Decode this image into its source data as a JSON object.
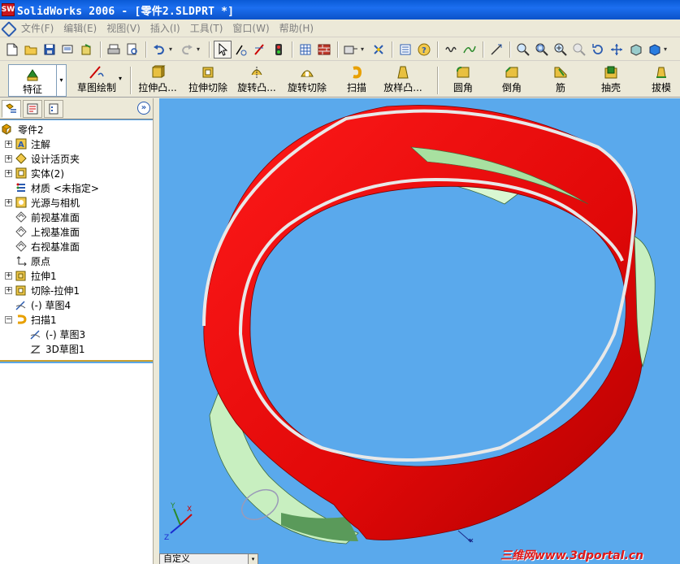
{
  "window": {
    "title": "SolidWorks 2006 - [零件2.SLDPRT *]",
    "app_icon_text": "SW"
  },
  "menu": {
    "items": [
      "文件(F)",
      "编辑(E)",
      "视图(V)",
      "插入(I)",
      "工具(T)",
      "窗口(W)",
      "帮助(H)"
    ]
  },
  "standard_toolbar": {
    "icons": [
      "new-document-icon",
      "open-icon",
      "save-icon",
      "print-preview-icon",
      "options-icon",
      "print-icon",
      "preview-icon",
      "undo-icon",
      "redo-icon",
      "select-icon",
      "smart-dimension-icon",
      "sketch-icon",
      "traffic-light-icon",
      "grid-icon",
      "brick-icon",
      "view-orientation-icon",
      "rebuild-icon",
      "properties-icon",
      "help-icon",
      "spring-icon",
      "curve-icon",
      "measure-icon",
      "zoom-to-fit-icon",
      "zoom-window-icon",
      "zoom-in-out-icon",
      "zoom-selection-icon",
      "rotate-icon",
      "pan-icon",
      "shaded-icon",
      "display-style-icon"
    ]
  },
  "feature_toolbar": {
    "modes": [
      {
        "label": "特征",
        "icon": "feature-icon"
      },
      {
        "label": "草图绘制",
        "icon": "sketch-draw-icon"
      }
    ],
    "buttons": [
      {
        "label": "拉伸凸...",
        "icon": "extrude-boss-icon"
      },
      {
        "label": "拉伸切除",
        "icon": "extrude-cut-icon"
      },
      {
        "label": "旋转凸...",
        "icon": "revolve-boss-icon"
      },
      {
        "label": "旋转切除",
        "icon": "revolve-cut-icon"
      },
      {
        "label": "扫描",
        "icon": "sweep-icon"
      },
      {
        "label": "放样凸...",
        "icon": "loft-icon"
      },
      {
        "label": "圆角",
        "icon": "fillet-icon"
      },
      {
        "label": "倒角",
        "icon": "chamfer-icon"
      },
      {
        "label": "筋",
        "icon": "rib-icon"
      },
      {
        "label": "抽壳",
        "icon": "shell-icon"
      },
      {
        "label": "拔模",
        "icon": "draft-icon"
      }
    ]
  },
  "feature_tree": {
    "collapse_symbol": "»",
    "root": "零件2",
    "items": [
      {
        "label": "注解",
        "icon": "annotation-icon",
        "expander": "+",
        "indent": 1
      },
      {
        "label": "设计活页夹",
        "icon": "design-binder-icon",
        "expander": "+",
        "indent": 1
      },
      {
        "label": "实体(2)",
        "icon": "solid-bodies-icon",
        "expander": "+",
        "indent": 1
      },
      {
        "label": "材质 <未指定>",
        "icon": "material-icon",
        "expander": "",
        "indent": 1
      },
      {
        "label": "光源与相机",
        "icon": "lights-icon",
        "expander": "+",
        "indent": 1
      },
      {
        "label": "前视基准面",
        "icon": "plane-icon",
        "expander": "",
        "indent": 1
      },
      {
        "label": "上视基准面",
        "icon": "plane-icon",
        "expander": "",
        "indent": 1
      },
      {
        "label": "右视基准面",
        "icon": "plane-icon",
        "expander": "",
        "indent": 1
      },
      {
        "label": "原点",
        "icon": "origin-icon",
        "expander": "",
        "indent": 1
      },
      {
        "label": "拉伸1",
        "icon": "extrude-icon",
        "expander": "+",
        "indent": 1
      },
      {
        "label": "切除-拉伸1",
        "icon": "cut-extrude-icon",
        "expander": "+",
        "indent": 1
      },
      {
        "label": "(-) 草图4",
        "icon": "sketch-icon",
        "expander": "",
        "indent": 1
      },
      {
        "label": "扫描1",
        "icon": "sweep-icon",
        "expander": "−",
        "indent": 1
      },
      {
        "label": "(-) 草图3",
        "icon": "sketch-icon",
        "expander": "",
        "indent": 2
      },
      {
        "label": "3D草图1",
        "icon": "3d-sketch-icon",
        "expander": "",
        "indent": 2
      }
    ]
  },
  "viewport": {
    "config_label": "自定义",
    "watermark": "三维网www.3dportal.cn",
    "triad": {
      "x": "X",
      "y": "Y",
      "z": "Z"
    },
    "colors": {
      "background": "#5aa9ec",
      "band_outer": "#e01010",
      "band_inner": "#d9f7d2",
      "rim": "#e8e8e8"
    }
  }
}
